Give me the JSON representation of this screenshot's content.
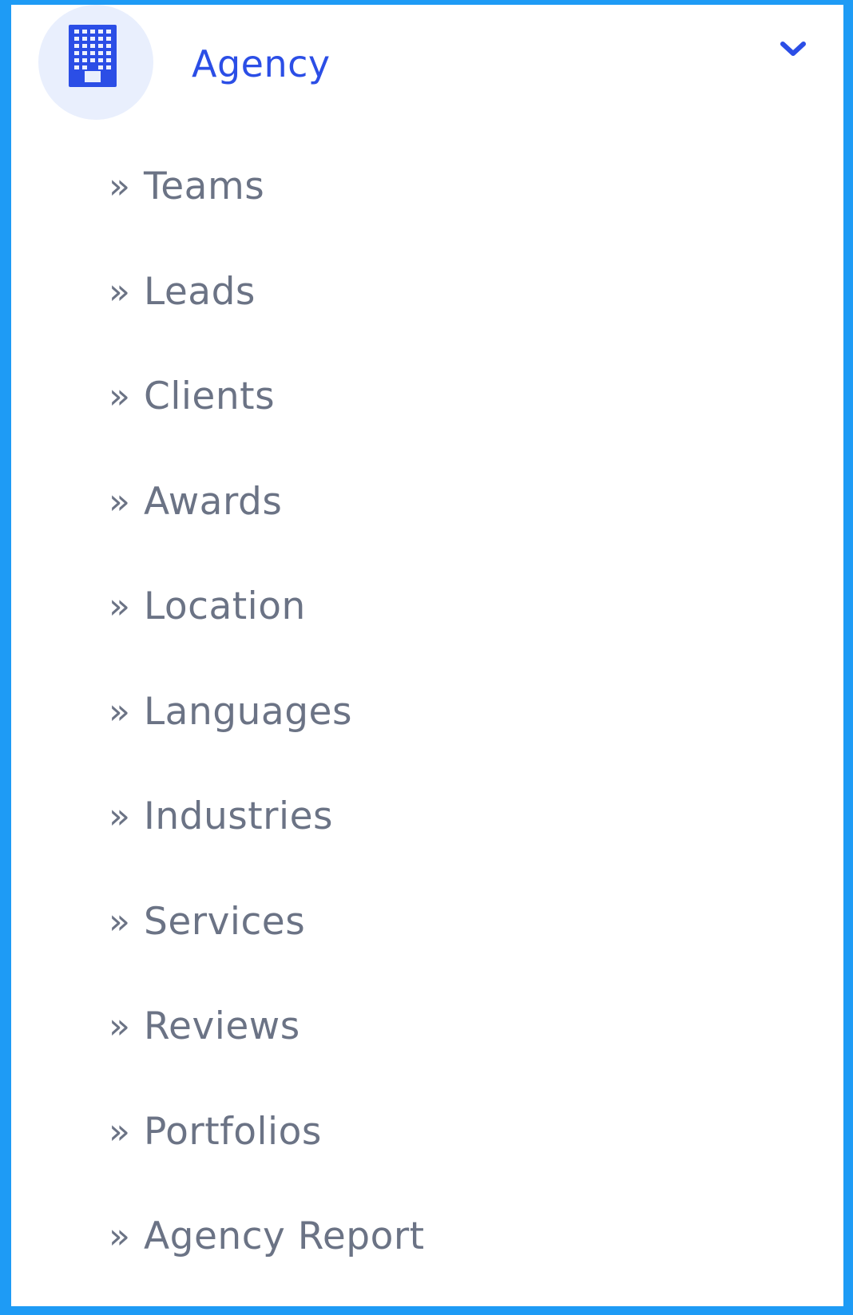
{
  "menu": {
    "header": {
      "label": "Agency",
      "icon": "building-icon",
      "expand_icon": "chevron-down-icon",
      "expanded": true
    },
    "arrow_glyph": "»",
    "items": [
      {
        "label": "Teams"
      },
      {
        "label": "Leads"
      },
      {
        "label": "Clients"
      },
      {
        "label": "Awards"
      },
      {
        "label": "Location"
      },
      {
        "label": "Languages"
      },
      {
        "label": "Industries"
      },
      {
        "label": "Services"
      },
      {
        "label": "Reviews"
      },
      {
        "label": "Portfolios"
      },
      {
        "label": "Agency Report"
      }
    ]
  },
  "colors": {
    "background": "#1e9bf5",
    "panel": "#ffffff",
    "accent": "#2b4ee6",
    "icon_circle": "#e9effd",
    "item_text": "#6b7385"
  }
}
